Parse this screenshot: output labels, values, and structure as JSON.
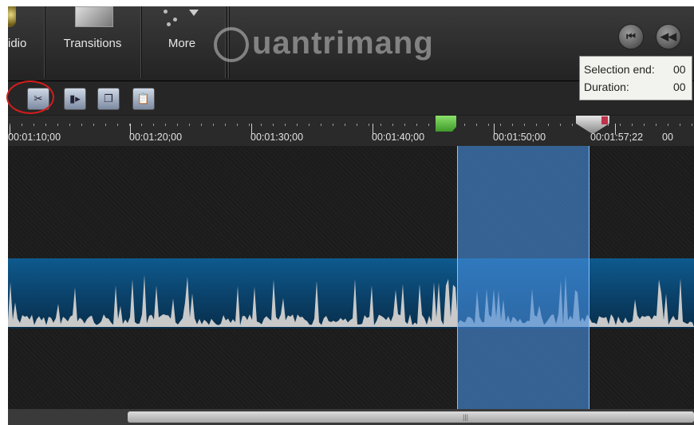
{
  "ribbon": {
    "audio_label": "idio",
    "transitions_label": "Transitions",
    "more_label": "More"
  },
  "watermark": {
    "text": "uantrimang"
  },
  "tooltip": {
    "selection_end_label": "Selection end:",
    "selection_end_value": "00",
    "duration_label": "Duration:",
    "duration_value": "00"
  },
  "playback": {
    "prev_label": "⏮",
    "rewind_label": "◀◀"
  },
  "ruler": {
    "labels": [
      "00:01:10;00",
      "00:01:20;00",
      "00:01:30;00",
      "00:01:40;00",
      "00:01:50;00",
      "00:01:57;22",
      "00"
    ]
  },
  "toolbar": {
    "cut_icon": "scissors-icon",
    "split_icon": "split-icon",
    "copy_icon": "copy-icon",
    "paste_icon": "paste-icon"
  },
  "colors": {
    "selection": "#468cdc",
    "audio_track": "#0e5a8e",
    "cut_highlight": "#d61c1c"
  }
}
